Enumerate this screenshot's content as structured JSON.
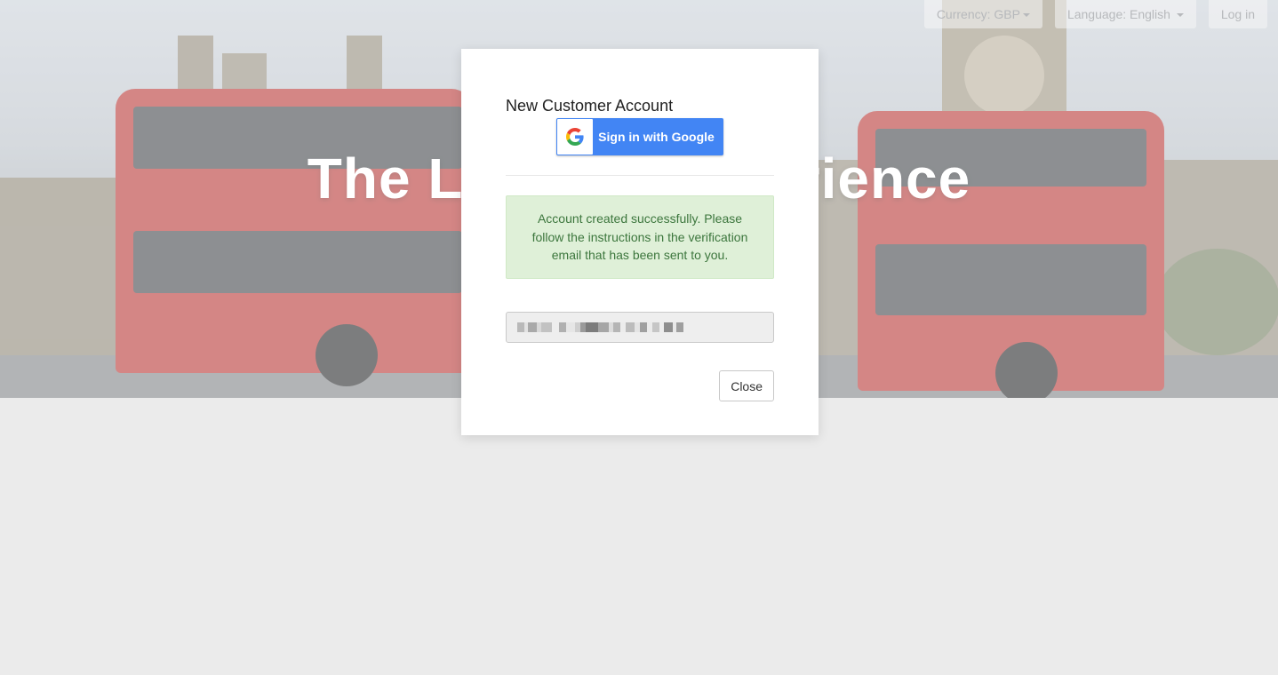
{
  "hero": {
    "title": "The London Experience"
  },
  "topnav": {
    "currency_label": "Currency: GBP",
    "language_label": "Language: English",
    "login_label": "Log in"
  },
  "modal": {
    "title": "New Customer Account",
    "google_button_label": "Sign in with Google",
    "success_message": "Account created successfully. Please follow the instructions in the verification email that has been sent to you.",
    "email_value_redacted": true,
    "close_label": "Close"
  },
  "icons": {
    "google": "google-g-logo-icon",
    "dropdown": "caret-down-icon"
  },
  "colors": {
    "google_blue": "#4285f4",
    "alert_bg": "#dff0d8",
    "alert_text": "#3c763d",
    "bus_red": "#b5302e"
  }
}
